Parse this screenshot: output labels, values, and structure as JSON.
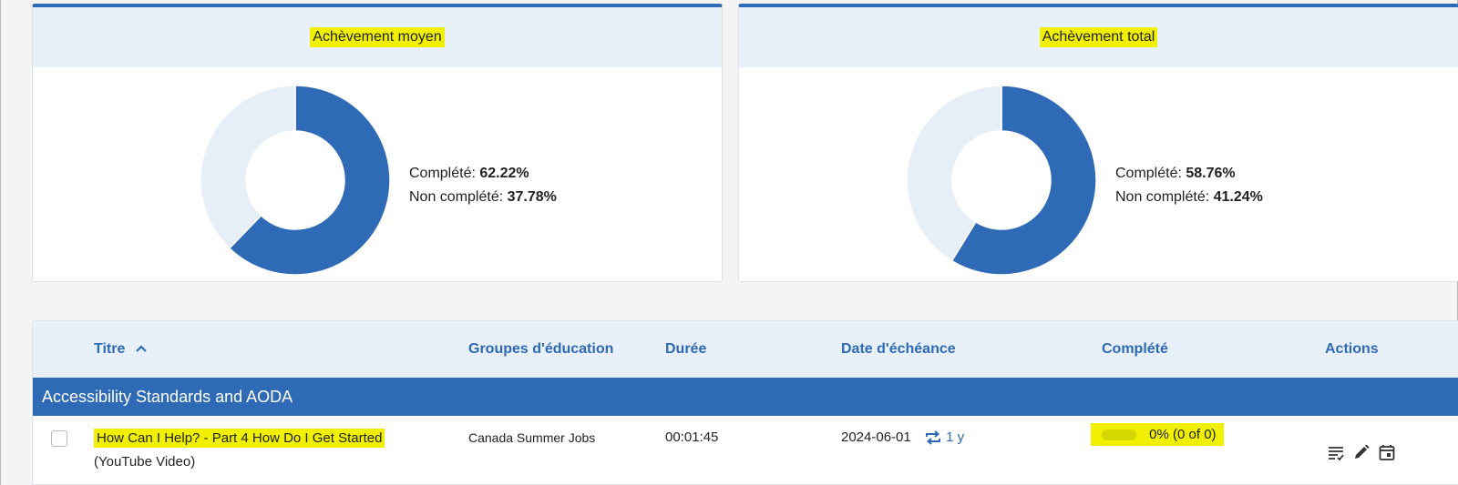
{
  "charts": {
    "left": {
      "title": "Achèvement moyen",
      "completed_label": "Complété:",
      "completed_value": "62.22%",
      "not_completed_label": "Non complété:",
      "not_completed_value": "37.78%"
    },
    "right": {
      "title": "Achèvement total",
      "completed_label": "Complété:",
      "completed_value": "58.76%",
      "not_completed_label": "Non complété:",
      "not_completed_value": "41.24%"
    }
  },
  "chart_data": [
    {
      "type": "pie",
      "title": "Achèvement moyen",
      "categories": [
        "Complété",
        "Non complété"
      ],
      "values": [
        62.22,
        37.78
      ],
      "colors": [
        "#2f6ab7",
        "#e6eef8"
      ]
    },
    {
      "type": "pie",
      "title": "Achèvement total",
      "categories": [
        "Complété",
        "Non complété"
      ],
      "values": [
        58.76,
        41.24
      ],
      "colors": [
        "#2f6ab7",
        "#e6eef8"
      ]
    }
  ],
  "table": {
    "headers": {
      "title": "Titre",
      "groups": "Groupes d'éducation",
      "duration": "Durée",
      "due": "Date d'échéance",
      "completed": "Complété",
      "actions": "Actions"
    },
    "group_name": "Accessibility Standards and AODA",
    "rows": [
      {
        "title": "How Can I Help? - Part 4 How Do I Get Started",
        "subtitle": "(YouTube Video)",
        "group": "Canada Summer Jobs",
        "duration": "00:01:45",
        "due_date": "2024-06-01",
        "recurrence": "1 y",
        "completed": "0% (0 of 0)",
        "completed_fraction": 0
      }
    ]
  },
  "colors": {
    "accent": "#2f6ab7",
    "header_bg": "#e8f0f9",
    "highlight": "#f0f000",
    "donut_remaining": "#e6eef8"
  }
}
